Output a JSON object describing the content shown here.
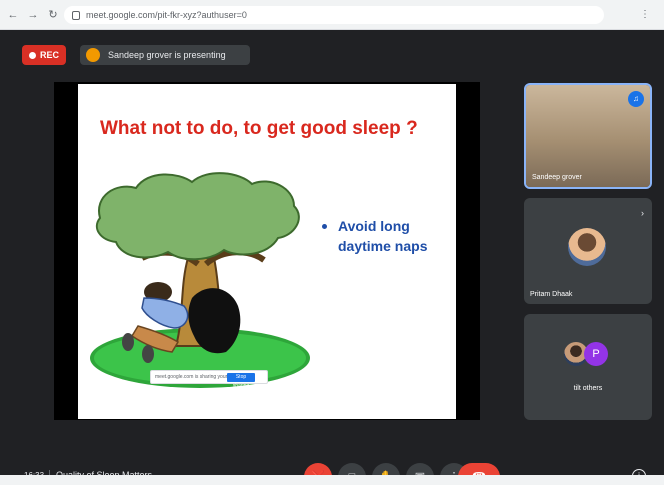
{
  "browser": {
    "back_icon": "arrow-left-icon",
    "forward_icon": "arrow-right-icon",
    "reload_icon": "reload-icon",
    "url": "meet.google.com/pit-fkr-xyz?authuser=0",
    "extension_icon": "puzzle-icon"
  },
  "meet": {
    "rec_label": "REC",
    "presenter_text": "Sandeep grover is presenting",
    "slide": {
      "title": "What not to do, to get good sleep ?",
      "bullet": "Avoid long daytime naps"
    },
    "share_bar": {
      "text": "meet.google.com is sharing your screen.",
      "button": "Stop sharing"
    },
    "participants": [
      {
        "name": "Sandeep grover"
      },
      {
        "name": "Pritam Dhaak"
      },
      {
        "name": "tilt others",
        "initial": "P"
      }
    ],
    "clock": "16:33",
    "meeting_title": "Quality of Sleep Matters"
  },
  "colors": {
    "accent": "#1a73e8",
    "danger": "#ea4335",
    "title_red": "#d9281e",
    "bullet_blue": "#1f4ea8"
  }
}
